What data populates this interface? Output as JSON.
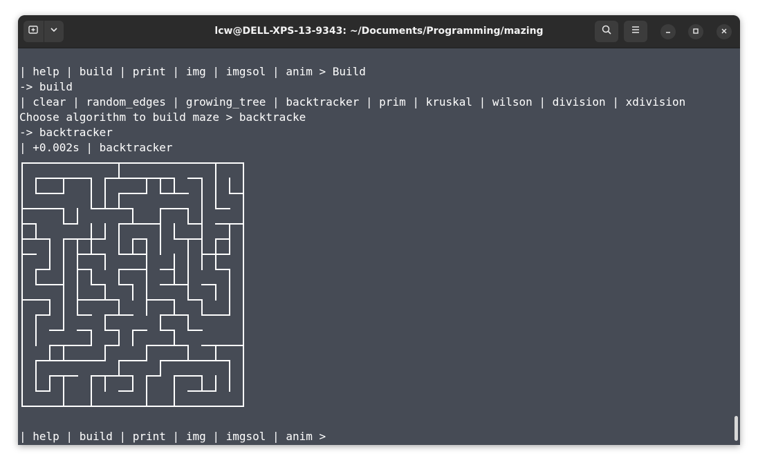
{
  "window": {
    "title": "lcw@DELL-XPS-13-9343: ~/Documents/Programming/mazing"
  },
  "icons": {
    "new_tab": "new-tab-icon",
    "dropdown": "chevron-down-icon",
    "search": "search-icon",
    "menu": "hamburger-menu-icon",
    "minimize": "minimize-icon",
    "maximize": "maximize-icon",
    "close": "close-icon"
  },
  "colors": {
    "terminal_bg": "#464b55",
    "titlebar_bg": "#2b2b2b",
    "text": "#ffffff"
  },
  "terminal": {
    "lines": [
      "| help | build | print | img | imgsol | anim > Build",
      "-> build",
      "| clear | random_edges | growing_tree | backtracker | prim | kruskal | wilson | division | xdivision",
      "Choose algorithm to build maze > backtracke",
      "-> backtracker",
      "| +0.002s | backtracker"
    ],
    "prompt": "| help | build | print | img | imgsol | anim > "
  },
  "maze": {
    "rows": 16,
    "cols": 16,
    "walls": [
      [
        [
          0,
          0
        ],
        [
          320,
          0
        ]
      ],
      [
        [
          0,
          0
        ],
        [
          0,
          352
        ]
      ],
      [
        [
          320,
          0
        ],
        [
          320,
          352
        ]
      ],
      [
        [
          0,
          352
        ],
        [
          320,
          352
        ]
      ],
      [
        [
          140,
          0
        ],
        [
          140,
          20
        ]
      ],
      [
        [
          280,
          0
        ],
        [
          280,
          66
        ]
      ],
      [
        [
          20,
          22
        ],
        [
          100,
          22
        ]
      ],
      [
        [
          120,
          22
        ],
        [
          220,
          22
        ]
      ],
      [
        [
          240,
          22
        ],
        [
          260,
          22
        ]
      ],
      [
        [
          20,
          22
        ],
        [
          20,
          44
        ]
      ],
      [
        [
          60,
          44
        ],
        [
          60,
          22
        ]
      ],
      [
        [
          100,
          22
        ],
        [
          100,
          66
        ]
      ],
      [
        [
          120,
          22
        ],
        [
          120,
          66
        ]
      ],
      [
        [
          180,
          22
        ],
        [
          180,
          44
        ]
      ],
      [
        [
          200,
          22
        ],
        [
          200,
          44
        ]
      ],
      [
        [
          200,
          44
        ],
        [
          240,
          44
        ]
      ],
      [
        [
          220,
          22
        ],
        [
          220,
          44
        ]
      ],
      [
        [
          260,
          22
        ],
        [
          260,
          66
        ]
      ],
      [
        [
          300,
          22
        ],
        [
          300,
          44
        ]
      ],
      [
        [
          300,
          44
        ],
        [
          320,
          44
        ]
      ],
      [
        [
          20,
          44
        ],
        [
          60,
          44
        ]
      ],
      [
        [
          140,
          44
        ],
        [
          140,
          66
        ]
      ],
      [
        [
          140,
          44
        ],
        [
          180,
          44
        ]
      ],
      [
        [
          0,
          66
        ],
        [
          60,
          66
        ]
      ],
      [
        [
          100,
          66
        ],
        [
          160,
          66
        ]
      ],
      [
        [
          200,
          66
        ],
        [
          240,
          66
        ]
      ],
      [
        [
          280,
          66
        ],
        [
          300,
          66
        ]
      ],
      [
        [
          80,
          66
        ],
        [
          80,
          88
        ]
      ],
      [
        [
          60,
          66
        ],
        [
          60,
          88
        ]
      ],
      [
        [
          160,
          66
        ],
        [
          160,
          88
        ]
      ],
      [
        [
          200,
          66
        ],
        [
          200,
          88
        ]
      ],
      [
        [
          240,
          66
        ],
        [
          240,
          88
        ]
      ],
      [
        [
          260,
          66
        ],
        [
          260,
          88
        ]
      ],
      [
        [
          0,
          88
        ],
        [
          20,
          88
        ]
      ],
      [
        [
          60,
          88
        ],
        [
          80,
          88
        ]
      ],
      [
        [
          140,
          88
        ],
        [
          180,
          88
        ]
      ],
      [
        [
          240,
          88
        ],
        [
          260,
          88
        ]
      ],
      [
        [
          280,
          88
        ],
        [
          320,
          88
        ]
      ],
      [
        [
          180,
          88
        ],
        [
          200,
          88
        ]
      ],
      [
        [
          20,
          88
        ],
        [
          20,
          110
        ]
      ],
      [
        [
          100,
          88
        ],
        [
          100,
          132
        ]
      ],
      [
        [
          120,
          88
        ],
        [
          120,
          110
        ]
      ],
      [
        [
          140,
          88
        ],
        [
          140,
          132
        ]
      ],
      [
        [
          200,
          88
        ],
        [
          200,
          110
        ]
      ],
      [
        [
          220,
          88
        ],
        [
          220,
          110
        ]
      ],
      [
        [
          260,
          88
        ],
        [
          260,
          110
        ]
      ],
      [
        [
          300,
          88
        ],
        [
          300,
          110
        ]
      ],
      [
        [
          0,
          110
        ],
        [
          40,
          110
        ]
      ],
      [
        [
          60,
          110
        ],
        [
          80,
          110
        ]
      ],
      [
        [
          80,
          110
        ],
        [
          120,
          110
        ]
      ],
      [
        [
          160,
          110
        ],
        [
          180,
          110
        ]
      ],
      [
        [
          220,
          110
        ],
        [
          260,
          110
        ]
      ],
      [
        [
          280,
          110
        ],
        [
          300,
          110
        ]
      ],
      [
        [
          40,
          110
        ],
        [
          40,
          154
        ]
      ],
      [
        [
          60,
          110
        ],
        [
          60,
          198
        ]
      ],
      [
        [
          80,
          110
        ],
        [
          80,
          154
        ]
      ],
      [
        [
          160,
          110
        ],
        [
          160,
          132
        ]
      ],
      [
        [
          180,
          110
        ],
        [
          180,
          154
        ]
      ],
      [
        [
          200,
          110
        ],
        [
          200,
          132
        ]
      ],
      [
        [
          240,
          110
        ],
        [
          240,
          132
        ]
      ],
      [
        [
          260,
          110
        ],
        [
          260,
          154
        ]
      ],
      [
        [
          280,
          110
        ],
        [
          280,
          132
        ]
      ],
      [
        [
          300,
          110
        ],
        [
          300,
          132
        ]
      ],
      [
        [
          0,
          132
        ],
        [
          20,
          132
        ]
      ],
      [
        [
          80,
          132
        ],
        [
          120,
          132
        ]
      ],
      [
        [
          140,
          132
        ],
        [
          180,
          132
        ]
      ],
      [
        [
          260,
          132
        ],
        [
          300,
          132
        ]
      ],
      [
        [
          120,
          132
        ],
        [
          120,
          154
        ]
      ],
      [
        [
          180,
          132
        ],
        [
          180,
          220
        ]
      ],
      [
        [
          220,
          132
        ],
        [
          220,
          176
        ]
      ],
      [
        [
          240,
          132
        ],
        [
          240,
          154
        ]
      ],
      [
        [
          280,
          132
        ],
        [
          280,
          154
        ]
      ],
      [
        [
          20,
          154
        ],
        [
          40,
          154
        ]
      ],
      [
        [
          80,
          154
        ],
        [
          100,
          154
        ]
      ],
      [
        [
          140,
          154
        ],
        [
          180,
          154
        ]
      ],
      [
        [
          200,
          154
        ],
        [
          220,
          154
        ]
      ],
      [
        [
          280,
          154
        ],
        [
          300,
          154
        ]
      ],
      [
        [
          20,
          154
        ],
        [
          20,
          176
        ]
      ],
      [
        [
          80,
          154
        ],
        [
          80,
          220
        ]
      ],
      [
        [
          100,
          154
        ],
        [
          100,
          176
        ]
      ],
      [
        [
          140,
          154
        ],
        [
          140,
          176
        ]
      ],
      [
        [
          240,
          154
        ],
        [
          240,
          198
        ]
      ],
      [
        [
          300,
          154
        ],
        [
          300,
          198
        ]
      ],
      [
        [
          20,
          176
        ],
        [
          60,
          176
        ]
      ],
      [
        [
          100,
          176
        ],
        [
          120,
          176
        ]
      ],
      [
        [
          140,
          176
        ],
        [
          160,
          176
        ]
      ],
      [
        [
          200,
          176
        ],
        [
          240,
          176
        ]
      ],
      [
        [
          260,
          176
        ],
        [
          280,
          176
        ]
      ],
      [
        [
          120,
          176
        ],
        [
          120,
          198
        ]
      ],
      [
        [
          160,
          176
        ],
        [
          160,
          198
        ]
      ],
      [
        [
          280,
          176
        ],
        [
          280,
          198
        ]
      ],
      [
        [
          0,
          198
        ],
        [
          40,
          198
        ]
      ],
      [
        [
          80,
          198
        ],
        [
          140,
          198
        ]
      ],
      [
        [
          180,
          198
        ],
        [
          220,
          198
        ]
      ],
      [
        [
          240,
          198
        ],
        [
          260,
          198
        ]
      ],
      [
        [
          40,
          198
        ],
        [
          40,
          220
        ]
      ],
      [
        [
          60,
          198
        ],
        [
          60,
          242
        ]
      ],
      [
        [
          140,
          198
        ],
        [
          140,
          220
        ]
      ],
      [
        [
          180,
          198
        ],
        [
          180,
          220
        ]
      ],
      [
        [
          220,
          198
        ],
        [
          220,
          220
        ]
      ],
      [
        [
          260,
          198
        ],
        [
          260,
          220
        ]
      ],
      [
        [
          300,
          198
        ],
        [
          300,
          220
        ]
      ],
      [
        [
          20,
          220
        ],
        [
          40,
          220
        ]
      ],
      [
        [
          80,
          220
        ],
        [
          100,
          220
        ]
      ],
      [
        [
          120,
          220
        ],
        [
          160,
          220
        ]
      ],
      [
        [
          200,
          220
        ],
        [
          240,
          220
        ]
      ],
      [
        [
          260,
          220
        ],
        [
          300,
          220
        ]
      ],
      [
        [
          20,
          220
        ],
        [
          20,
          264
        ]
      ],
      [
        [
          120,
          220
        ],
        [
          120,
          242
        ]
      ],
      [
        [
          200,
          220
        ],
        [
          200,
          242
        ]
      ],
      [
        [
          240,
          220
        ],
        [
          240,
          242
        ]
      ],
      [
        [
          40,
          242
        ],
        [
          60,
          242
        ]
      ],
      [
        [
          80,
          242
        ],
        [
          100,
          242
        ]
      ],
      [
        [
          120,
          242
        ],
        [
          140,
          242
        ]
      ],
      [
        [
          160,
          242
        ],
        [
          180,
          242
        ]
      ],
      [
        [
          200,
          242
        ],
        [
          220,
          242
        ]
      ],
      [
        [
          240,
          242
        ],
        [
          260,
          242
        ]
      ],
      [
        [
          100,
          242
        ],
        [
          100,
          264
        ]
      ],
      [
        [
          140,
          242
        ],
        [
          140,
          264
        ]
      ],
      [
        [
          160,
          242
        ],
        [
          160,
          264
        ]
      ],
      [
        [
          220,
          242
        ],
        [
          220,
          264
        ]
      ],
      [
        [
          40,
          264
        ],
        [
          100,
          264
        ]
      ],
      [
        [
          120,
          264
        ],
        [
          140,
          264
        ]
      ],
      [
        [
          180,
          264
        ],
        [
          240,
          264
        ]
      ],
      [
        [
          260,
          264
        ],
        [
          320,
          264
        ]
      ],
      [
        [
          40,
          264
        ],
        [
          40,
          286
        ]
      ],
      [
        [
          60,
          264
        ],
        [
          60,
          286
        ]
      ],
      [
        [
          120,
          264
        ],
        [
          120,
          286
        ]
      ],
      [
        [
          180,
          264
        ],
        [
          180,
          286
        ]
      ],
      [
        [
          240,
          264
        ],
        [
          240,
          286
        ]
      ],
      [
        [
          280,
          264
        ],
        [
          280,
          286
        ]
      ],
      [
        [
          20,
          286
        ],
        [
          120,
          286
        ]
      ],
      [
        [
          140,
          286
        ],
        [
          180,
          286
        ]
      ],
      [
        [
          200,
          286
        ],
        [
          260,
          286
        ]
      ],
      [
        [
          260,
          286
        ],
        [
          300,
          286
        ]
      ],
      [
        [
          20,
          286
        ],
        [
          20,
          330
        ]
      ],
      [
        [
          140,
          286
        ],
        [
          140,
          308
        ]
      ],
      [
        [
          200,
          286
        ],
        [
          200,
          308
        ]
      ],
      [
        [
          300,
          286
        ],
        [
          300,
          308
        ]
      ],
      [
        [
          40,
          308
        ],
        [
          80,
          308
        ]
      ],
      [
        [
          100,
          308
        ],
        [
          160,
          308
        ]
      ],
      [
        [
          180,
          308
        ],
        [
          200,
          308
        ]
      ],
      [
        [
          220,
          308
        ],
        [
          260,
          308
        ]
      ],
      [
        [
          40,
          308
        ],
        [
          40,
          330
        ]
      ],
      [
        [
          100,
          308
        ],
        [
          100,
          330
        ]
      ],
      [
        [
          120,
          308
        ],
        [
          120,
          330
        ]
      ],
      [
        [
          160,
          308
        ],
        [
          160,
          330
        ]
      ],
      [
        [
          260,
          308
        ],
        [
          260,
          330
        ]
      ],
      [
        [
          280,
          308
        ],
        [
          280,
          330
        ]
      ],
      [
        [
          300,
          308
        ],
        [
          300,
          330
        ]
      ],
      [
        [
          20,
          330
        ],
        [
          40,
          330
        ]
      ],
      [
        [
          140,
          330
        ],
        [
          160,
          330
        ]
      ],
      [
        [
          240,
          330
        ],
        [
          280,
          330
        ]
      ],
      [
        [
          60,
          308
        ],
        [
          60,
          352
        ]
      ],
      [
        [
          100,
          330
        ],
        [
          100,
          352
        ]
      ],
      [
        [
          180,
          308
        ],
        [
          180,
          352
        ]
      ],
      [
        [
          220,
          308
        ],
        [
          220,
          352
        ]
      ]
    ]
  }
}
